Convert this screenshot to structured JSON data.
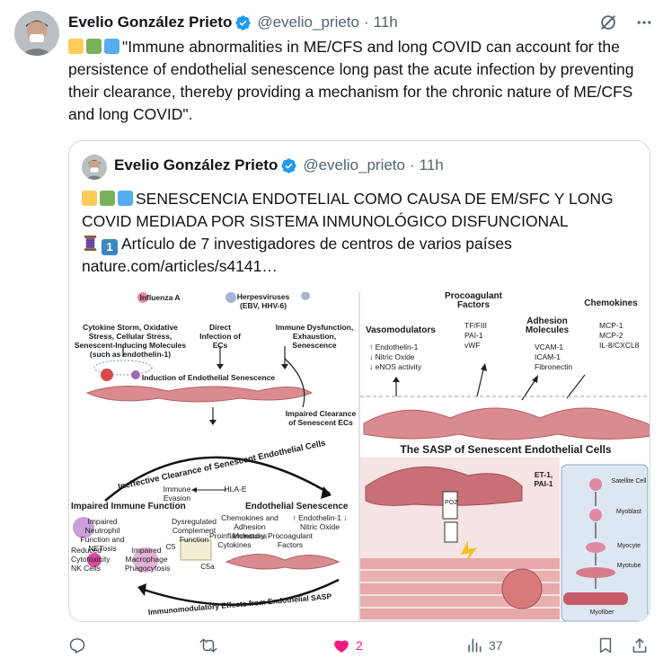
{
  "post": {
    "author_name": "Evelio González Prieto",
    "handle": "@evelio_prieto",
    "separator": "·",
    "time": "11h",
    "text_before_icons": "",
    "text": "\"Immune abnormalities in ME/CFS and long COVID can account for the persistence of endothelial senescence long past the acute infection by preventing their clearance, thereby providing a mechanism for the chronic nature of ME/CFS and long COVID\"."
  },
  "quoted_post": {
    "author_name": "Evelio González Prieto",
    "handle": "@evelio_prieto",
    "separator": "·",
    "time": "11h",
    "line1": "SENESCENCIA ENDOTELIAL COMO CAUSA DE EM/SFC Y LONG COVID MEDIADA POR SISTEMA INMUNOLÓGICO DISFUNCIONAL",
    "line2": "Artículo de 7 investigadores de centros de varios países",
    "number_emoji": "1",
    "link": "nature.com/articles/s4141…"
  },
  "figure": {
    "left": {
      "virus_a": "Influenza A",
      "virus_b": "Herpesviruses (EBV, HHV-6)",
      "col1": "Cytokine Storm, Oxidative Stress, Cellular Stress, Senescent-Inducing Molecules (such as endothelin-1)",
      "col2": "Direct Infection of ECs",
      "col3": "Immune Dysfunction, Exhaustion, Senescence",
      "induction": "Induction of Endothelial Senescence",
      "impaired_clearance": "Impaired Clearance of Senescent ECs",
      "ineffective": "Ineffective Clearance of Senescent Endothelial Cells",
      "immune_evasion": "Immune Evasion",
      "hla": "HLA-E",
      "impaired_immune": "Impaired Immune Function",
      "endo_senescence": "Endothelial Senescence",
      "neutrophil": "Impaired Neutrophil Function and NETosis",
      "complement": "Dysregulated Complement Function",
      "cytotox": "Reduced Cytotoxicity NK Cells",
      "macrophage": "Impaired Macrophage Phagocytosis",
      "c5": "C5",
      "c5a": "C5a",
      "chemokines_adhesion": "Chemokines and Adhesion Molecules",
      "endothelin_up": "↑ Endothelin-1 ↓ Nitric Oxide",
      "proinflammatory": "Proinflammatory Cytokines",
      "procoag_factors": "Procoagulant Factors",
      "immunomod": "Immunomodulatory Effects from Endothelial SASP"
    },
    "right": {
      "vasomodulators": "Vasomodulators",
      "vaso_items": [
        "↑ Endothelin-1",
        "↓ Nitric Oxide",
        "↓ eNOS activity"
      ],
      "procoag_title": "Procoagulant Factors",
      "procoag_items": [
        "TF/FIII",
        "PAI-1",
        "vWF"
      ],
      "adhesion_title": "Adhesion Molecules",
      "adhesion_items": [
        "VCAM-1",
        "ICAM-1",
        "Fibronectin"
      ],
      "chemokines_title": "Chemokines",
      "chemokines_items": [
        "MCP-1",
        "MCP-2",
        "IL-8/CXCL8"
      ],
      "sasp_title": "The SASP of Senescent Endothelial Cells",
      "et1": "ET-1, PAI-1",
      "po2": "PO2",
      "myo_stages": [
        "Satellite Cell",
        "Myoblast",
        "Myocyte",
        "Myotube",
        "Myofiber"
      ]
    }
  },
  "actions": {
    "reply_count": "",
    "repost_count": "",
    "like_count": "2",
    "views_count": "37"
  },
  "colors": {
    "accent": "#1d9bf0",
    "like": "#f91880",
    "muted": "#536471",
    "verified": "#1d9bf0"
  }
}
